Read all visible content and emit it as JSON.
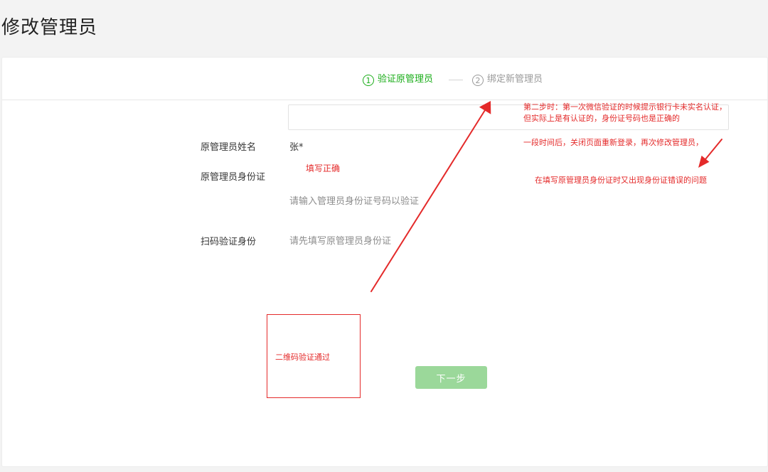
{
  "page": {
    "title": "修改管理员"
  },
  "steps": [
    {
      "number": "1",
      "label": "验证原管理员",
      "state": "active"
    },
    {
      "number": "2",
      "label": "绑定新管理员",
      "state": "pending"
    }
  ],
  "form": {
    "name_label": "原管理员姓名",
    "name_value": "张*",
    "id_label": "原管理员身份证",
    "id_value": "",
    "id_hint": "请输入管理员身份证号码以验证",
    "scan_label": "扫码验证身份",
    "scan_hint": "请先填写原管理员身份证"
  },
  "buttons": {
    "next": "下一步"
  },
  "annotations": {
    "filled_correctly": "填写正确",
    "note_line1": "第二步时：第一次微信验证的时候提示银行卡未实名认证，",
    "note_line2": "但实际上是有认证的，身份证号码也是正确的",
    "note_line3": "一段时间后，关闭页面重新登录，再次修改管理员，",
    "note_line4": "在填写原管理员身份证时又出现身份证错误的问题",
    "qr_passed": "二维码验证通过"
  },
  "colors": {
    "accent_green": "#1aad19",
    "button_disabled": "#9bd89a",
    "annotation_red": "#e42a2a"
  }
}
